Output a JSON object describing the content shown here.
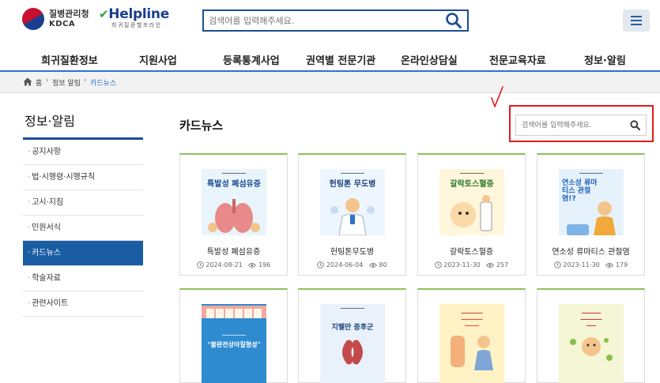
{
  "header": {
    "kdca_kr": "질병관리청",
    "kdca_en": "KDCA",
    "helpline_main": "Helpline",
    "helpline_sub": "희귀질환헬프라인",
    "search_placeholder": "검색어를 입력해주세요."
  },
  "gnb": [
    "희귀질환정보",
    "지원사업",
    "등록통계사업",
    "권역별 전문기관",
    "온라인상담실",
    "전문교육자료",
    "정보·알림"
  ],
  "breadcrumb": {
    "home": "홈",
    "level1": "정보 알림",
    "level2": "카드뉴스"
  },
  "sidebar": {
    "title": "정보·알림",
    "items": [
      {
        "label": "공지사항"
      },
      {
        "label": "법·시행령·시행규칙"
      },
      {
        "label": "고시·지침"
      },
      {
        "label": "민원서식"
      },
      {
        "label": "카드뉴스",
        "active": true
      },
      {
        "label": "학술자료"
      },
      {
        "label": "관련사이트"
      }
    ]
  },
  "content": {
    "title": "카드뉴스",
    "search_placeholder": "검색어를 입력해주세요."
  },
  "cards": [
    {
      "title": "특발성 폐섬유증",
      "date": "2024-08-21",
      "views": "196",
      "thumb_title": "특발성 폐섬유증",
      "bg": "#e9f4fb",
      "accent": "#1b4d96"
    },
    {
      "title": "헌팅톤무도병",
      "date": "2024-06-04",
      "views": "80",
      "thumb_title": "헌팅톤 무도병",
      "bg": "#edf6ff",
      "accent": "#1b3e7a"
    },
    {
      "title": "갈락토스혈증",
      "date": "2023-11-30",
      "views": "257",
      "thumb_title": "갈락토스혈증",
      "bg": "#fff6dc",
      "accent": "#2a7a2a"
    },
    {
      "title": "연소성 류마티스 관절염",
      "date": "2023-11-30",
      "views": "179",
      "thumb_title": "연소성 류마티스 관절염!?",
      "bg": "#e6f2fb",
      "accent": "#1f5fbf"
    }
  ],
  "cards_row2": [
    {
      "thumb_title": "\"불완전상아질형성\"",
      "bg": "#2e8bd0",
      "accent": "#ffffff"
    },
    {
      "thumb_title": "지텔만 증후군",
      "bg": "#e9f1fa",
      "accent": "#1b3e7a"
    },
    {
      "thumb_title": "",
      "bg": "#fff3c6",
      "accent": "#e8262c"
    },
    {
      "thumb_title": "",
      "bg": "#f4f6d6",
      "accent": "#c8102e"
    }
  ],
  "colors": {
    "primary": "#1b5da3",
    "gnb_border": "#2a74c9",
    "annotation": "#e01b1b",
    "card_top": "#8fbf5a"
  }
}
